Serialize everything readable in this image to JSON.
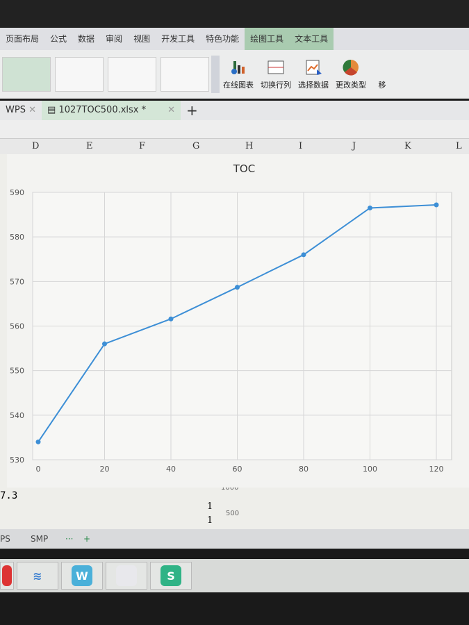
{
  "menu": [
    "页面布局",
    "公式",
    "数据",
    "审阅",
    "视图",
    "开发工具",
    "特色功能",
    "绘图工具",
    "文本工具"
  ],
  "ribbon": {
    "online_chart": "在线图表",
    "switch_rowcol": "切换行列",
    "select_data": "选择数据",
    "change_type": "更改类型",
    "move": "移"
  },
  "tabs": {
    "prev": "WPS",
    "file": "1027TOC500.xlsx *",
    "add": "+"
  },
  "columns": [
    "D",
    "E",
    "F",
    "G",
    "H",
    "I",
    "J",
    "K",
    "L"
  ],
  "sheet_tabs": [
    "PS",
    "SMP",
    "···",
    "+"
  ],
  "background_cells": {
    "left": "7.3",
    "mid1": "1",
    "mid2": "1",
    "axis1": "1000",
    "axis2": "500"
  },
  "colors": {
    "series": "#3d8fd6",
    "accent_green": "#a9cbb0"
  },
  "chart_data": {
    "type": "line",
    "title": "TOC",
    "x": [
      0,
      20,
      40,
      60,
      80,
      100,
      120
    ],
    "series": [
      {
        "values": [
          534,
          556,
          561.6,
          568.7,
          576,
          586.5,
          587.2
        ]
      }
    ],
    "xlim": [
      0,
      120
    ],
    "ylim": [
      530,
      590
    ],
    "xticks": [
      0,
      20,
      40,
      60,
      80,
      100,
      120
    ],
    "yticks": [
      530,
      540,
      550,
      560,
      570,
      580,
      590
    ],
    "grid": true,
    "legend": "none"
  }
}
